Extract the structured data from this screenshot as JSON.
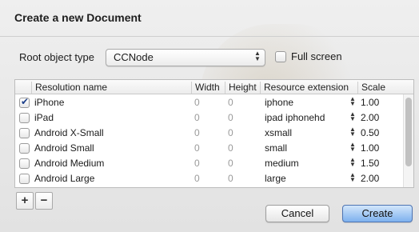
{
  "dialog": {
    "title": "Create a new Document",
    "root_label": "Root object type",
    "root_value": "CCNode",
    "fullscreen_label": "Full screen",
    "fullscreen_checked": false
  },
  "table": {
    "headers": [
      "Resolution name",
      "Width",
      "Height",
      "Resource extension",
      "Scale"
    ],
    "rows": [
      {
        "checked": true,
        "name": "iPhone",
        "width": "0",
        "height": "0",
        "ext": "iphone",
        "scale": "1.00"
      },
      {
        "checked": false,
        "name": "iPad",
        "width": "0",
        "height": "0",
        "ext": "ipad iphonehd",
        "scale": "2.00"
      },
      {
        "checked": false,
        "name": "Android X-Small",
        "width": "0",
        "height": "0",
        "ext": "xsmall",
        "scale": "0.50"
      },
      {
        "checked": false,
        "name": "Android Small",
        "width": "0",
        "height": "0",
        "ext": "small",
        "scale": "1.00"
      },
      {
        "checked": false,
        "name": "Android Medium",
        "width": "0",
        "height": "0",
        "ext": "medium",
        "scale": "1.50"
      },
      {
        "checked": false,
        "name": "Android Large",
        "width": "0",
        "height": "0",
        "ext": "large",
        "scale": "2.00"
      }
    ]
  },
  "controls": {
    "add_label": "+",
    "remove_label": "−",
    "cancel_label": "Cancel",
    "create_label": "Create"
  }
}
